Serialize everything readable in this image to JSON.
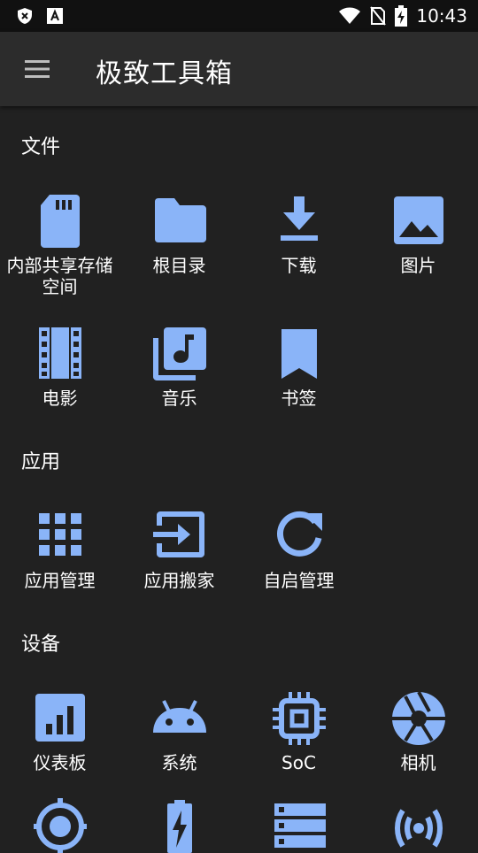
{
  "status": {
    "time": "10:43"
  },
  "toolbar": {
    "title": "极致工具箱"
  },
  "sections": {
    "files": {
      "title": "文件",
      "items": [
        "内部共享存储空间",
        "根目录",
        "下载",
        "图片",
        "电影",
        "音乐",
        "书签"
      ]
    },
    "apps": {
      "title": "应用",
      "items": [
        "应用管理",
        "应用搬家",
        "自启管理"
      ]
    },
    "device": {
      "title": "设备",
      "items": [
        "仪表板",
        "系统",
        "SoC",
        "相机"
      ]
    }
  },
  "colors": {
    "accent": "#8ab4f8",
    "background": "#212121",
    "toolbar": "#2c2c2c",
    "statusbar": "#111111"
  }
}
